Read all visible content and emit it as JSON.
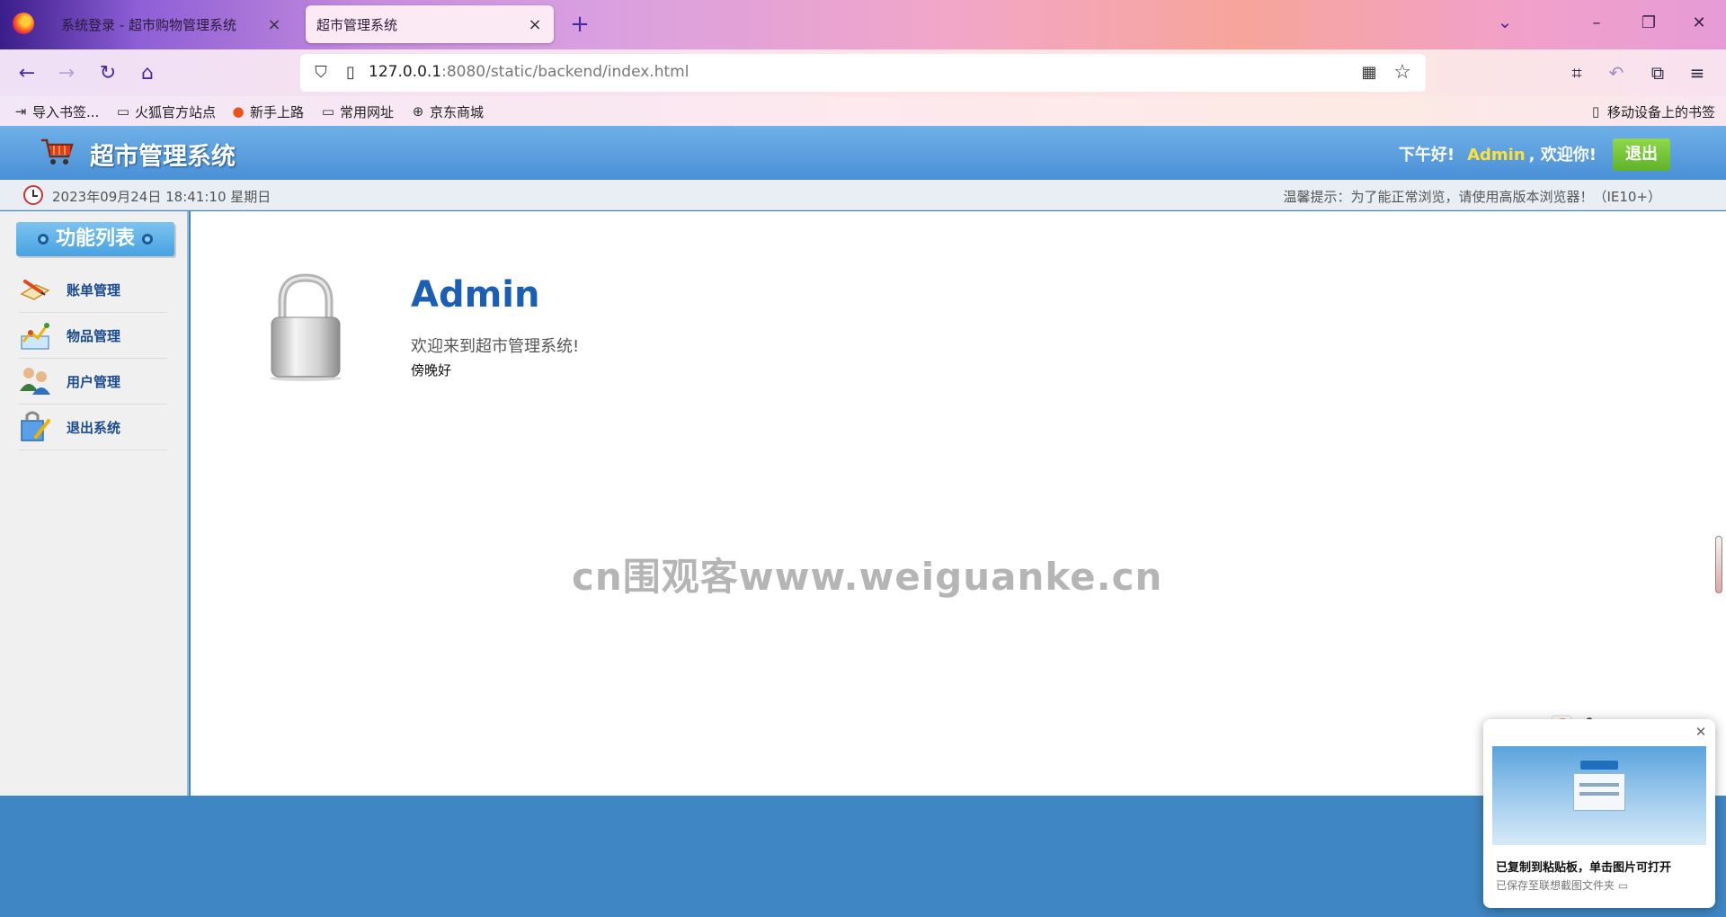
{
  "browser": {
    "tabs": [
      {
        "title": "系统登录 - 超市购物管理系统",
        "active": false
      },
      {
        "title": "超市管理系统",
        "active": true
      }
    ],
    "new_tab_icon": "plus-icon",
    "url_host": "127.0.0.1",
    "url_rest": ":8080/static/backend/index.html",
    "bookmarks": [
      {
        "label": "导入书签...",
        "icon": "import-icon"
      },
      {
        "label": "火狐官方站点",
        "icon": "folder-icon"
      },
      {
        "label": "新手上路",
        "icon": "firefox-icon"
      },
      {
        "label": "常用网址",
        "icon": "folder-icon"
      },
      {
        "label": "京东商城",
        "icon": "globe-icon"
      }
    ],
    "mobile_bookmarks": "移动设备上的书签"
  },
  "header": {
    "site_title": "超市管理系统",
    "greeting": "下午好!",
    "username": "Admin",
    "welcome_suffix": ", 欢迎你!",
    "logout": "退出"
  },
  "infobar": {
    "datetime": "2023年09月24日 18:41:10 星期日",
    "tip": "温馨提示：为了能正常浏览，请使用高版本浏览器！（IE10+）"
  },
  "sidebar": {
    "title": "功能列表",
    "items": [
      {
        "label": "账单管理",
        "icon": "bill-icon"
      },
      {
        "label": "物品管理",
        "icon": "goods-icon"
      },
      {
        "label": "用户管理",
        "icon": "users-icon"
      },
      {
        "label": "退出系统",
        "icon": "exit-icon"
      }
    ]
  },
  "main": {
    "name": "Admin",
    "welcome": "欢迎来到超市管理系统!",
    "evening": "傍晚好"
  },
  "watermark": "cn围观客www.weiguanke.cn",
  "toast": {
    "title": "已复制到粘贴板，单击图片可打开",
    "subtitle": "已保存至联想截图文件夹"
  },
  "colors": {
    "header_blue": "#4a90d6",
    "page_blue": "#3f87c4",
    "username_yellow": "#ffe03a",
    "logout_green": "#5fb22a",
    "admin_blue": "#1a5fb4"
  }
}
